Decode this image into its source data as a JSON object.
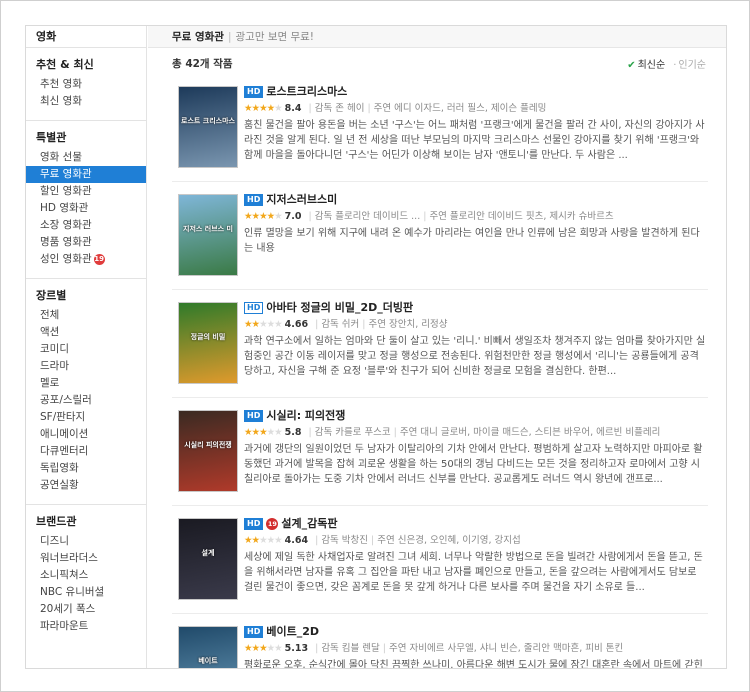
{
  "sidebar": {
    "root": "영화",
    "groups": [
      {
        "heading": "추천 & 최신",
        "items": [
          "추천 영화",
          "최신 영화"
        ]
      },
      {
        "heading": "특별관",
        "items": [
          "영화 선물",
          "무료 영화관",
          "할인 영화관",
          "HD 영화관",
          "소장 영화관",
          "명품 영화관",
          "성인 영화관"
        ],
        "active_index": 1,
        "adult_badge": "19"
      },
      {
        "heading": "장르별",
        "items": [
          "전체",
          "액션",
          "코미디",
          "드라마",
          "멜로",
          "공포/스릴러",
          "SF/판타지",
          "애니메이션",
          "다큐멘터리",
          "독립영화",
          "공연실황"
        ]
      },
      {
        "heading": "브랜드관",
        "items": [
          "디즈니",
          "워너브라더스",
          "소니픽쳐스",
          "NBC 유니버셜",
          "20세기 폭스",
          "파라마운트"
        ]
      }
    ]
  },
  "topbar": {
    "title": "무료 영화관",
    "separator": "|",
    "subtitle": "광고만 보면 무료!"
  },
  "list": {
    "total": "총 42개 작품",
    "sort_active": "최신순",
    "sort_inactive": "인기순",
    "movies": [
      {
        "title": "로스트크리스마스",
        "hd": "HD",
        "rating_fraction": 0.84,
        "score": "8.4",
        "director": "감독 존 헤이",
        "cast": "주연 에디 이자드, 러러 필스, 제이슨 플레밍",
        "desc": "훔친 물건을 팔아 용돈을 버는 소년 '구스'는 어느 패처럼 '프랭크'에게 물건을 팔러 간 사이, 자신의 강아지가 사라진 것을 알게 된다. 일 년 전 세상을 떠난 부모님의 마지막 크리스마스 선물인 강아지를 찾기 위해 '프랭크'와 함께 마을을 돌아다니던 '구스'는 어딘가 이상해 보이는 남자 '앤토니'를 만난다. 두 사람은 ...",
        "poster_title": "로스트 크리스마스",
        "poster_colors": [
          "#1d3a5a",
          "#7a96b0"
        ]
      },
      {
        "title": "지저스러브스미",
        "hd": "HD",
        "rating_fraction": 0.7,
        "score": "7.0",
        "director": "감독 플로리안 데이비드 ...",
        "cast": "주연 플로리안 데이비드 핏츠, 제시카 슈바르츠",
        "desc": "인류 멸망을 보기 위해 지구에 내려 온 예수가 마리라는 여인을 만나 인류에 남은 희망과 사랑을 발견하게 된다는 내용",
        "poster_title": "지저스 러브스 미",
        "poster_colors": [
          "#7fb6d8",
          "#3a7a45"
        ]
      },
      {
        "title": "아바타 정글의 비밀_2D_더빙판",
        "hd": "HD",
        "rating_fraction": 0.466,
        "score": "4.66",
        "director": "감독 쉬커",
        "cast": "주연 장안치, 리정샹",
        "desc": "과학 연구소에서 일하는 엄마와 단 둘이 살고 있는 '리니.' 비빼서 생일조차 챙겨주지 않는 엄마를 찾아가지만 실험중인 공간 이동 레이저를 맞고 정글 행성으로 전송된다. 위험천만한 정글 행성에서 '리니'는 공룡들에게 공격 당하고, 자신을 구해 준 요정 '블루'와 친구가 되어 신비한 정글로 모험을 결심한다. 한편...",
        "poster_title": "정글의 비밀",
        "poster_colors": [
          "#2f7a2a",
          "#e09a2c"
        ]
      },
      {
        "title": "시실리: 피의전쟁",
        "hd": "HD",
        "rating_fraction": 0.58,
        "score": "5.8",
        "director": "감독 카를로 푸스코",
        "cast": "주연 대니 글로버, 마이클 매드슨, 스티븐 바우어, 에르빈 비플레리",
        "desc": "과거에 갱단의 일원이었던 두 남자가 이탈리아의 기차 안에서 만난다. 평범하게 살고자 노력하지만 마피아로 활동했던 과거에 발목을 잡혀 괴로운 생활을 하는 50대의 갱님 다비드는 모든 것을 정리하고자 로마에서 고향 시칠리아로 돌아가는 도중 기차 안에서 러너드 신부를 만난다. 공교롭게도 러너드 역시 왕년에 갠프로...",
        "poster_title": "시실리 피의전쟁",
        "poster_colors": [
          "#3a2a22",
          "#b03a2a"
        ]
      },
      {
        "title": "설계_감독판",
        "hd": "HD",
        "age": "19",
        "rating_fraction": 0.464,
        "score": "4.64",
        "director": "감독 박창진",
        "cast": "주연 신은경, 오인혜, 이기영, 강지섭",
        "desc": "세상에 제일 독한 사채업자로 알려진 그녀 세희. 너무나 악랄한 방법으로 돈을 빌려간 사람에게서 돈을 뜯고, 돈을 위해서라면 남자를 유혹 그 집안을 파탄 내고 남자를 폐인으로 만들고, 돈을 갚으려는 사람에게서도 담보로 걸린 물건이 좋으면, 갖은 꼼계로 돈을 못 갚게 하거나 다른 보사를 주며 물건을 자기 소유로 들...",
        "poster_title": "설계",
        "poster_colors": [
          "#1a1a22",
          "#3a3a4a"
        ]
      },
      {
        "title": "베이트_2D",
        "hd": "HD",
        "rating_fraction": 0.513,
        "score": "5.13",
        "director": "감독 킴블 렌달",
        "cast": "주연 자비에르 사무엘, 샤니 빈슨, 줄리안 맥마흔, 피비 톤킨",
        "desc": "평화로운 오후, 순식간에 몰아 닥친 끔찍한 쓰나미. 아름다운 해변 도시가 물에 잠긴 대혼란 속에서 마트에 갇힌 사람들은 생존을 위해",
        "poster_title": "베이트",
        "poster_colors": [
          "#204a6a",
          "#6a9ab8"
        ]
      }
    ]
  },
  "icons": {
    "check": "check-icon",
    "dot": "dot-icon",
    "star": "star-icon"
  },
  "colors": {
    "accent": "#1f7fd6",
    "star": "#f2a71b",
    "adult": "#d32f2f",
    "check": "#2aa34a"
  }
}
